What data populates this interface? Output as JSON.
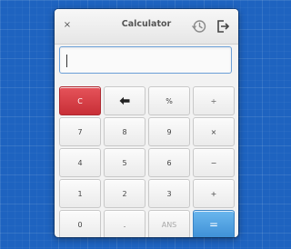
{
  "window": {
    "title": "Calculator",
    "close_glyph": "×",
    "history_icon": "history-icon",
    "export_icon": "export-icon"
  },
  "display": {
    "value": ""
  },
  "keypad": {
    "clear": "C",
    "backspace_icon": "backspace-arrow-icon",
    "percent": "%",
    "divide": "÷",
    "seven": "7",
    "eight": "8",
    "nine": "9",
    "multiply": "×",
    "four": "4",
    "five": "5",
    "six": "6",
    "subtract": "−",
    "one": "1",
    "two": "2",
    "three": "3",
    "add": "+",
    "zero": "0",
    "decimal": ".",
    "ans": "ANS",
    "equals": "="
  },
  "colors": {
    "desktop": "#1e63c0",
    "clear_button": "#d93a42",
    "equals_button": "#4a9ce0",
    "display_focus_border": "#6b9fd7"
  }
}
